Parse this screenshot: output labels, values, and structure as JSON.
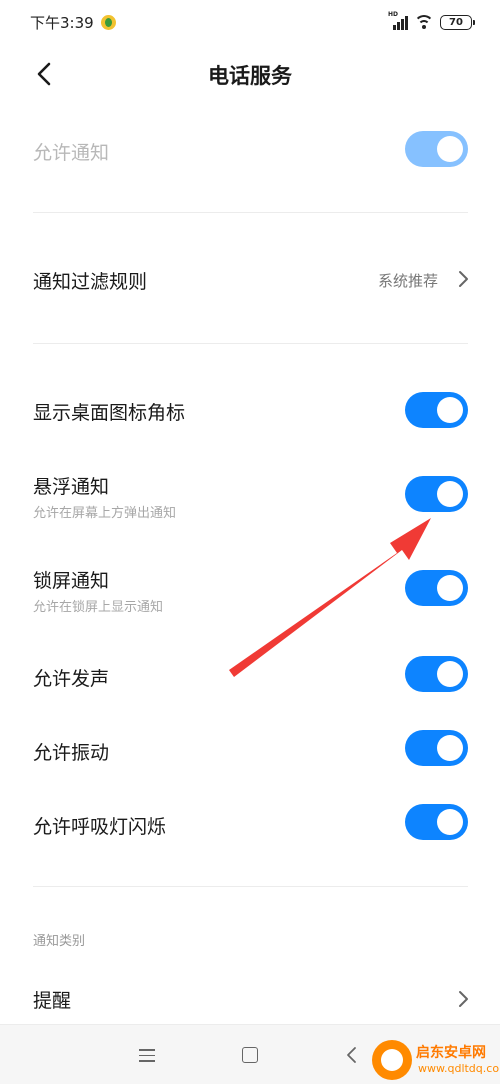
{
  "status_bar": {
    "time": "下午3:39",
    "signal_label": "HD",
    "battery": "70"
  },
  "header": {
    "title": "电话服务"
  },
  "settings": {
    "allow_notification": {
      "title": "允许通知",
      "enabled": true,
      "disabled": true
    },
    "filter_rules": {
      "title": "通知过滤规则",
      "value": "系统推荐"
    },
    "badge": {
      "title": "显示桌面图标角标",
      "enabled": true
    },
    "floating": {
      "title": "悬浮通知",
      "subtitle": "允许在屏幕上方弹出通知",
      "enabled": true
    },
    "lockscreen": {
      "title": "锁屏通知",
      "subtitle": "允许在锁屏上显示通知",
      "enabled": true
    },
    "sound": {
      "title": "允许发声",
      "enabled": true
    },
    "vibrate": {
      "title": "允许振动",
      "enabled": true
    },
    "led": {
      "title": "允许呼吸灯闪烁",
      "enabled": true
    }
  },
  "categories": {
    "section_label": "通知类别",
    "items": [
      {
        "title": "提醒"
      }
    ]
  },
  "watermark": {
    "name": "启东安卓网",
    "url": "www.qdltdq.com"
  },
  "colors": {
    "accent": "#0d84ff",
    "accent_disabled": "#86c1ff",
    "arrow": "#f03a35"
  }
}
